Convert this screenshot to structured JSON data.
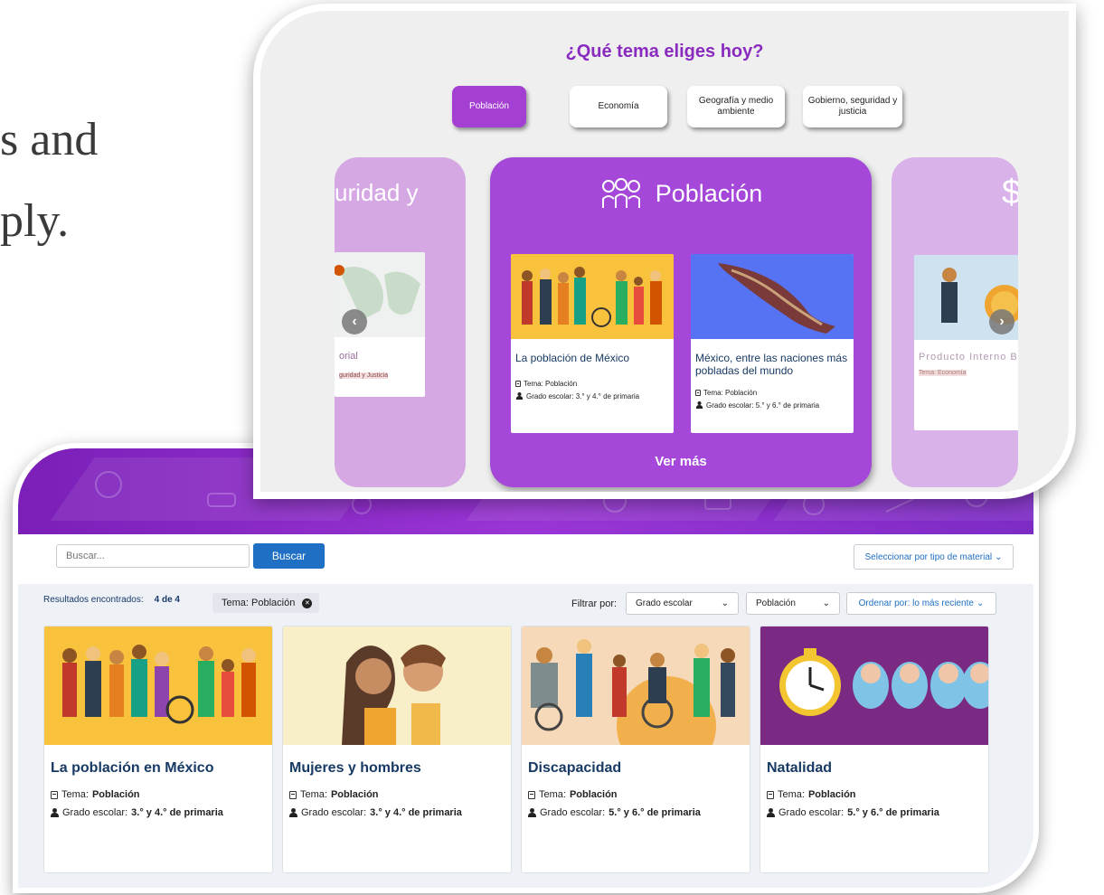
{
  "background": {
    "line1": "s and",
    "line2": "ply."
  },
  "catalog": {
    "search": {
      "placeholder": "Buscar...",
      "button": "Buscar"
    },
    "material_select": "Seleccionar por tipo de material",
    "results_label": "Resultados encontrados:",
    "results_count": "4 de 4",
    "active_tag": "Tema: Población",
    "filter_label": "Filtrar por:",
    "grade_select": "Grado escolar",
    "topic_select": "Población",
    "order_select": "Ordenar por: lo más reciente",
    "tema_label": "Tema:",
    "grado_label": "Grado escolar:",
    "cards": [
      {
        "title": "La población en México",
        "tema": "Población",
        "grado": "3.° y 4.° de primaria"
      },
      {
        "title": "Mujeres y hombres",
        "tema": "Población",
        "grado": "3.° y 4.° de primaria"
      },
      {
        "title": "Discapacidad",
        "tema": "Población",
        "grado": "5.° y 6.° de primaria"
      },
      {
        "title": "Natalidad",
        "tema": "Población",
        "grado": "5.° y 6.° de primaria"
      }
    ]
  },
  "topics": {
    "title": "¿Qué tema eliges hoy?",
    "tabs": [
      "Población",
      "Economía",
      "Geografía y medio ambiente",
      "Gobierno, seguridad y justicia"
    ],
    "active_tab": "Población",
    "left_card": {
      "heading": "uridad y",
      "mini_title": "orial",
      "mini_tag": "guridad y Justicia"
    },
    "center_card": {
      "heading": "Población",
      "items": [
        {
          "title": "La población de México",
          "tema": "Tema: Población",
          "grado": "Grado escolar: 3.° y 4.° de primaria"
        },
        {
          "title": "México, entre las naciones más pobladas del mundo",
          "tema": "Tema: Población",
          "grado": "Grado escolar: 5.° y 6.° de primaria"
        }
      ],
      "ver_mas": "Ver más"
    },
    "right_card": {
      "heading": "$",
      "mini_title": "Producto Interno Br",
      "mini_tag": "Tema: Economía"
    }
  },
  "colors": {
    "purple": "#a548d9",
    "header_purple": "#8a2bbf",
    "link_blue": "#1f6fc4",
    "title_navy": "#173a64"
  }
}
